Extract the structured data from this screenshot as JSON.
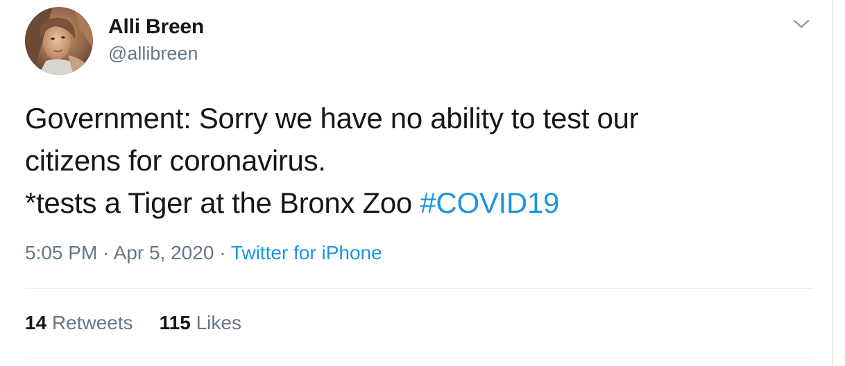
{
  "user": {
    "display_name": "Alli Breen",
    "handle": "@allibreen"
  },
  "tweet": {
    "line1": "Government: Sorry we have no ability to test our",
    "line2": "citizens for coronavirus.",
    "line3": "*tests a Tiger at the Bronx Zoo",
    "hashtag": "#COVID19"
  },
  "meta": {
    "time": "5:05 PM",
    "separator": "·",
    "date": "Apr 5, 2020",
    "source": "Twitter for iPhone"
  },
  "stats": {
    "retweets_count": "14",
    "retweets_label": "Retweets",
    "likes_count": "115",
    "likes_label": "Likes"
  },
  "icons": {
    "menu": "chevron-down-icon"
  },
  "colors": {
    "link": "#1b95e0",
    "secondary": "#657786",
    "primary": "#14171a",
    "divider": "#e6ecf0"
  }
}
